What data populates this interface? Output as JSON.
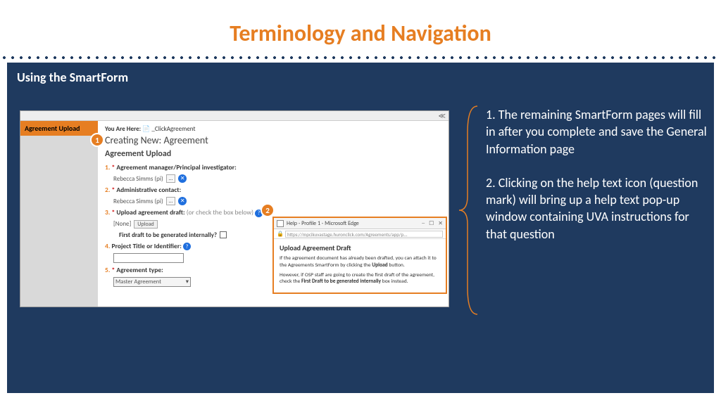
{
  "title": "Terminology and Navigation",
  "panel_title": "Using the SmartForm",
  "markers": {
    "m1": "1",
    "m2": "2"
  },
  "screenshot": {
    "nav_tab": "Agreement Upload",
    "breadcrumb_label": "You Are Here:",
    "breadcrumb_val": "_ClickAgreement",
    "h1": "Creating New: Agreement",
    "h2": "Agreement Upload",
    "q1": {
      "num": "1.",
      "label": "Agreement manager/Principal investigator:",
      "val": "Rebecca Simms (pi)",
      "dots": "…"
    },
    "q2": {
      "num": "2.",
      "label": "Administrative contact:",
      "val": "Rebecca Simms (pi)",
      "dots": "…"
    },
    "q3": {
      "num": "3.",
      "label": "Upload agreement draft:",
      "hint": "(or check the box below)",
      "none": "[None]",
      "upload": "Upload",
      "cb_label": "First draft to be generated internally?"
    },
    "q4": {
      "num": "4.",
      "label": "Project Title or Identifier:"
    },
    "q5": {
      "num": "5.",
      "label": "Agreement type:",
      "val": "Master Agreement"
    }
  },
  "popup": {
    "title": "Help - Profile 1 - Microsoft Edge",
    "url": "https://mpcikuvastage.huronclick.com/Agreements/app/p...",
    "heading": "Upload Agreement Draft",
    "p1a": "If the agreement document has already been drafted, you can attach it to the Agreements SmartForm by clicking the ",
    "p1b": "Upload",
    "p1c": " button.",
    "p2a": "However, if OSP staff are going to create the first draft of the agreement, check the ",
    "p2b": "First Draft to be generated internally",
    "p2c": " box instead."
  },
  "notes": {
    "n1": "1. The remaining SmartForm pages will fill in after you complete and save the General Information page",
    "n2": "2. Clicking on the help text icon (question mark) will bring up a help text pop-up window containing UVA instructions for that question"
  }
}
